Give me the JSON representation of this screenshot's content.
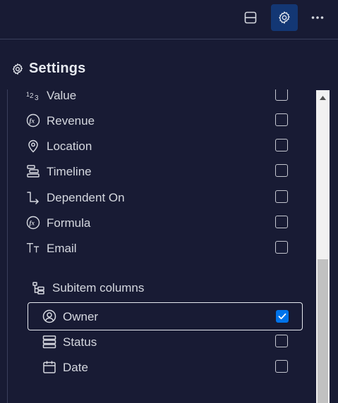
{
  "toolbar": {
    "buttons": [
      {
        "icon": "split-view-icon"
      },
      {
        "icon": "gear-icon",
        "active": true
      },
      {
        "icon": "more-dots-icon"
      }
    ]
  },
  "settings": {
    "title": "Settings",
    "icon": "gear-icon"
  },
  "columns": [
    {
      "label": "Value",
      "icon": "numbers-icon",
      "checked": false
    },
    {
      "label": "Revenue",
      "icon": "formula-icon",
      "checked": false
    },
    {
      "label": "Location",
      "icon": "location-pin-icon",
      "checked": false
    },
    {
      "label": "Timeline",
      "icon": "timeline-icon",
      "checked": false
    },
    {
      "label": "Dependent On",
      "icon": "dependency-icon",
      "checked": false
    },
    {
      "label": "Formula",
      "icon": "formula-icon",
      "checked": false
    },
    {
      "label": "Email",
      "icon": "text-icon",
      "checked": false
    }
  ],
  "subitem_group": {
    "label": "Subitem columns",
    "icon": "subitems-icon",
    "items": [
      {
        "label": "Owner",
        "icon": "person-icon",
        "checked": true
      },
      {
        "label": "Status",
        "icon": "status-icon",
        "checked": false
      },
      {
        "label": "Date",
        "icon": "calendar-icon",
        "checked": false
      }
    ]
  },
  "colors": {
    "background": "#181b34",
    "accent": "#0073ea",
    "active_button": "#133774"
  }
}
